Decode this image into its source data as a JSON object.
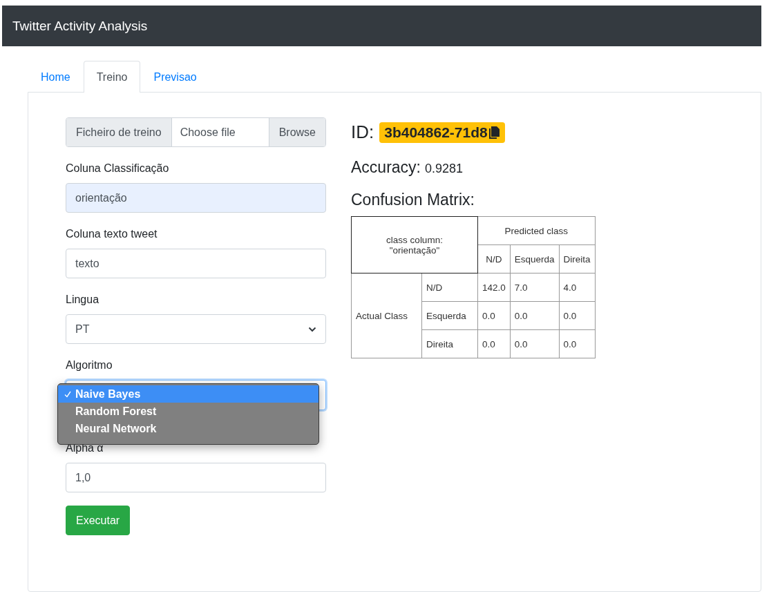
{
  "navbar": {
    "title": "Twitter Activity Analysis"
  },
  "tabs": [
    {
      "label": "Home",
      "selected": false
    },
    {
      "label": "Treino",
      "selected": true
    },
    {
      "label": "Previsao",
      "selected": false
    }
  ],
  "form": {
    "file_input": {
      "label": "Ficheiro de treino",
      "placeholder": "Choose file",
      "button": "Browse"
    },
    "fields": [
      {
        "kind": "text",
        "label": "Coluna Classificação",
        "value": "orientação",
        "autofilled": true
      },
      {
        "kind": "text",
        "label": "Coluna texto tweet",
        "value": "texto",
        "autofilled": false
      },
      {
        "kind": "select",
        "label": "Lingua",
        "value": "PT"
      },
      {
        "kind": "select_open",
        "label": "Algoritmo",
        "options": [
          {
            "label": "Naive Bayes",
            "selected": true
          },
          {
            "label": "Random Forest",
            "selected": false
          },
          {
            "label": "Neural Network",
            "selected": false
          }
        ]
      },
      {
        "kind": "text",
        "label": "Alpha α",
        "value": "1,0",
        "autofilled": false
      }
    ],
    "submit": "Executar"
  },
  "results": {
    "id_label": "ID:",
    "id_value": "3b404862-71d8",
    "accuracy_label": "Accuracy:",
    "accuracy_value": "0.9281",
    "matrix_title": "Confusion Matrix:",
    "matrix": {
      "corner": "class column: \"orientação\"",
      "predicted_header": "Predicted class",
      "actual_header": "Actual Class",
      "columns": [
        "N/D",
        "Esquerda",
        "Direita"
      ],
      "rows": [
        {
          "label": "N/D",
          "values": [
            "142.0",
            "7.0",
            "4.0"
          ]
        },
        {
          "label": "Esquerda",
          "values": [
            "0.0",
            "0.0",
            "0.0"
          ]
        },
        {
          "label": "Direita",
          "values": [
            "0.0",
            "0.0",
            "0.0"
          ]
        }
      ]
    }
  }
}
